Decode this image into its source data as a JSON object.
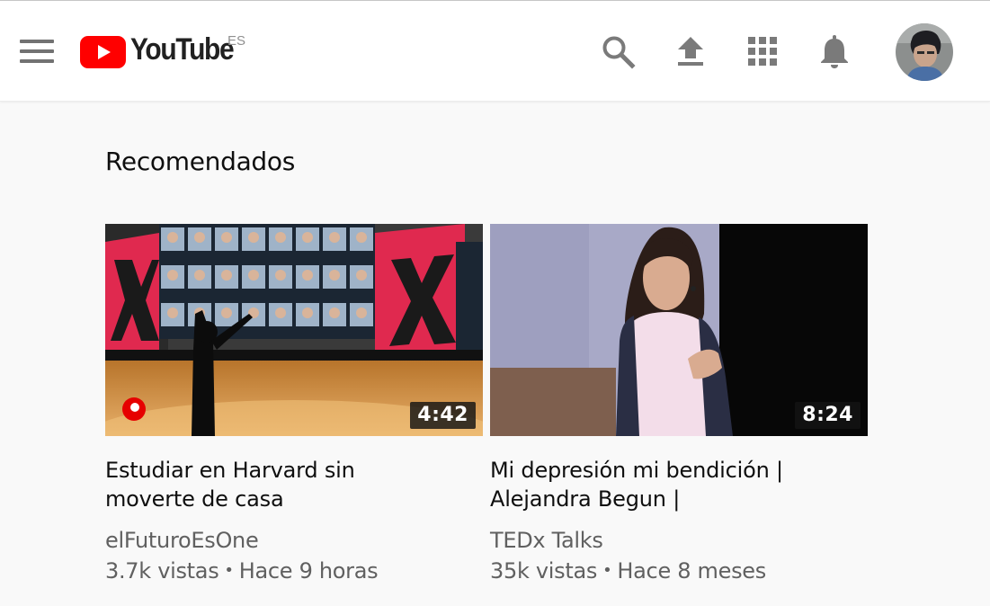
{
  "header": {
    "logo_text": "YouTube",
    "region": "ES",
    "brand_color": "#ff0000",
    "icons": [
      "menu-icon",
      "search-icon",
      "upload-icon",
      "apps-icon",
      "notifications-icon",
      "account-avatar"
    ]
  },
  "main": {
    "section_title": "Recomendados",
    "videos": [
      {
        "duration": "4:42",
        "title_line1": "Estudiar en Harvard sin",
        "title_line2": "moverte de casa",
        "channel": "elFuturoEsOne",
        "views": "3.7k vistas",
        "age": "Hace 9 horas"
      },
      {
        "duration": "8:24",
        "title_line1": "Mi depresión mi bendición |",
        "title_line2": "Alejandra Begun |",
        "channel": "TEDx Talks",
        "views": "35k vistas",
        "age": "Hace 8 meses"
      }
    ]
  },
  "separator": "•"
}
